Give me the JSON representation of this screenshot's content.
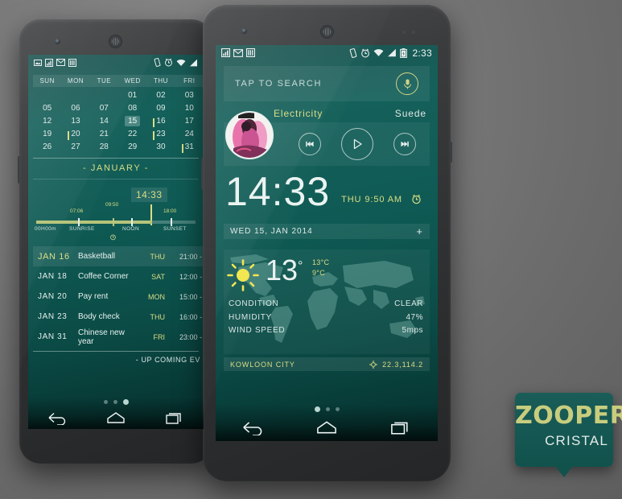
{
  "background": {
    "accent_yellow": "#d9dd84",
    "screen_teal": "#0f5a54"
  },
  "left_phone": {
    "status_bar": {
      "icons_left": [
        "image-icon",
        "signal-bars-icon",
        "mail-icon",
        "equalizer-icon"
      ],
      "icons_right": [
        "vibrate-icon",
        "alarm-icon",
        "wifi-icon",
        "signal-icon"
      ]
    },
    "calendar": {
      "weekday_headers": [
        "SUN",
        "MON",
        "TUE",
        "WED",
        "THU",
        "FRI"
      ],
      "weeks": [
        [
          {
            "d": ""
          },
          {
            "d": ""
          },
          {
            "d": ""
          },
          {
            "d": "01"
          },
          {
            "d": "02"
          },
          {
            "d": "03"
          }
        ],
        [
          {
            "d": "05"
          },
          {
            "d": "06"
          },
          {
            "d": "07"
          },
          {
            "d": "08"
          },
          {
            "d": "09"
          },
          {
            "d": "10"
          }
        ],
        [
          {
            "d": "12"
          },
          {
            "d": "13"
          },
          {
            "d": "14"
          },
          {
            "d": "15",
            "today": true
          },
          {
            "d": "16",
            "event": true
          },
          {
            "d": "17"
          }
        ],
        [
          {
            "d": "19"
          },
          {
            "d": "20",
            "event": true
          },
          {
            "d": "21"
          },
          {
            "d": "22"
          },
          {
            "d": "23",
            "event": true
          },
          {
            "d": "24"
          }
        ],
        [
          {
            "d": "26"
          },
          {
            "d": "27"
          },
          {
            "d": "28"
          },
          {
            "d": "29"
          },
          {
            "d": "30"
          },
          {
            "d": "31",
            "event": true
          }
        ]
      ],
      "month_label": "- JANUARY -"
    },
    "timeline": {
      "start_label": "00H00m",
      "sunrise_label": "SUNRISE",
      "sunrise_time": "07:06",
      "alarm_time": "09:50",
      "noon_label": "NOON",
      "sunset_label": "SUNSET",
      "sunset_time": "18:00",
      "now_badge": "14:33"
    },
    "events": {
      "rows": [
        {
          "date": "JAN 16",
          "name": "Basketball",
          "day": "THU",
          "time": "21:00 -",
          "highlight": true
        },
        {
          "date": "JAN 18",
          "name": "Coffee Corner",
          "day": "SAT",
          "time": "12:00 -",
          "highlight": false
        },
        {
          "date": "JAN 20",
          "name": "Pay rent",
          "day": "MON",
          "time": "15:00 -",
          "highlight": false
        },
        {
          "date": "JAN 23",
          "name": "Body check",
          "day": "THU",
          "time": "16:00 -",
          "highlight": false
        },
        {
          "date": "JAN 31",
          "name": "Chinese new year",
          "day": "FRI",
          "time": "23:00 -",
          "highlight": false
        }
      ],
      "footer": "- UP COMING EV"
    },
    "nav": {
      "dots": 3,
      "active_dot": 3,
      "back": "back-icon",
      "home": "home-icon",
      "recents": "recents-icon"
    }
  },
  "right_phone": {
    "status_bar": {
      "icons_left": [
        "signal-bars-icon",
        "mail-icon",
        "equalizer-icon"
      ],
      "icons_right": [
        "vibrate-icon",
        "alarm-icon",
        "wifi-icon",
        "signal-icon",
        "battery-icon"
      ],
      "time": "2:33"
    },
    "search": {
      "placeholder": "TAP TO SEARCH",
      "mic": "microphone-icon"
    },
    "player": {
      "track": "Electricity",
      "artist": "Suede",
      "previous": "previous-track-icon",
      "play": "play-icon",
      "next": "next-track-icon"
    },
    "clock": {
      "time": "14:33",
      "alt_time": "THU 9:50 AM",
      "alarm_icon": "alarm-icon",
      "date": "WED 15, JAN 2014",
      "add": "+"
    },
    "weather": {
      "icon": "sun-icon",
      "temperature": "13",
      "degree": "°",
      "high": "13°C",
      "low": "9°C",
      "labels": [
        "CONDITION",
        "HUMIDITY",
        "WIND SPEED"
      ],
      "values": [
        "CLEAR",
        "47%",
        "5mps"
      ],
      "location": "KOWLOON CITY",
      "coordinates": "22.3,114.2",
      "coord_icon": "crosshair-icon"
    },
    "nav": {
      "dots": 3,
      "active_dot": 1,
      "back": "back-icon",
      "home": "home-icon",
      "recents": "recents-icon"
    }
  },
  "badge": {
    "title": "ZOOPER",
    "subtitle": "CRISTAL"
  }
}
